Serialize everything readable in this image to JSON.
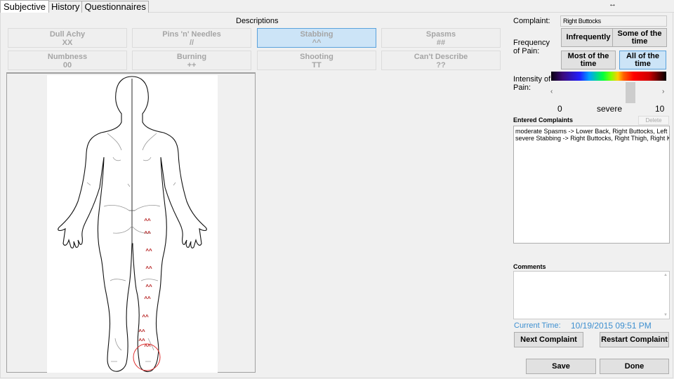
{
  "tabs": [
    {
      "label": "Subjective",
      "active": true
    },
    {
      "label": "History",
      "active": false
    },
    {
      "label": "Questionnaires",
      "active": false
    }
  ],
  "resize_glyph": "↔",
  "descriptions": {
    "title": "Descriptions",
    "items": [
      {
        "label": "Dull Achy",
        "symbol": "XX",
        "selected": false
      },
      {
        "label": "Pins 'n' Needles",
        "symbol": "//",
        "selected": false
      },
      {
        "label": "Stabbing",
        "symbol": "^^",
        "selected": true
      },
      {
        "label": "Spasms",
        "symbol": "##",
        "selected": false
      },
      {
        "label": "Numbness",
        "symbol": "00",
        "selected": false
      },
      {
        "label": "Burning",
        "symbol": "++",
        "selected": false
      },
      {
        "label": "Shooting",
        "symbol": "TT",
        "selected": false
      },
      {
        "label": "Can't Describe",
        "symbol": "??",
        "selected": false
      }
    ]
  },
  "diagram": {
    "view": "posterior body outline",
    "marker_symbol": "^^",
    "marker_color": "#b01010",
    "marker_count": 10,
    "selection_circle_color": "#e03030"
  },
  "complaint": {
    "label": "Complaint:",
    "value": "Right Buttocks"
  },
  "frequency": {
    "label": "Frequency of Pain:",
    "options": [
      {
        "label": "Infrequently",
        "selected": false
      },
      {
        "label": "Some of the time",
        "selected": false
      },
      {
        "label": "Most of the time",
        "selected": false
      },
      {
        "label": "All of the time",
        "selected": true
      }
    ]
  },
  "intensity": {
    "label": "Intensity of Pain:",
    "min_label": "0",
    "max_label": "10",
    "current_label": "severe",
    "value_fraction": 0.72,
    "left_arrow": "‹",
    "right_arrow": "›"
  },
  "entered_complaints": {
    "label": "Entered Complaints",
    "delete_label": "Delete",
    "items": [
      "moderate Spasms -> Lower Back, Right Buttocks, Left Buttocks",
      "severe Stabbing -> Right Buttocks, Right Thigh, Right Knee, Right Calf"
    ]
  },
  "comments": {
    "label": "Comments",
    "value": ""
  },
  "current_time": {
    "label": "Current Time:",
    "value": "10/19/2015  09:51 PM"
  },
  "buttons": {
    "next_complaint": "Next Complaint",
    "restart_complaint": "Restart Complaint",
    "save": "Save",
    "done": "Done"
  },
  "colors": {
    "selected_bg": "#cce4f7",
    "selected_border": "#5aa2dc",
    "time_text": "#3d8fd0",
    "disabled_text": "#a5a5a5"
  }
}
